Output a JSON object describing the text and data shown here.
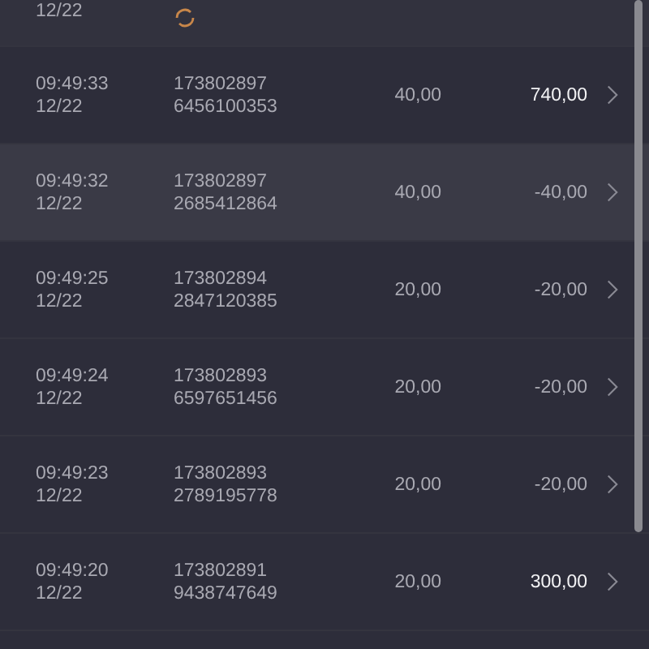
{
  "top_row": {
    "date": "12/22",
    "pending": true
  },
  "rows": [
    {
      "time": "09:49:33",
      "date": "12/22",
      "id_1": "173802897",
      "id_2": "6456100353",
      "quantity": "40,00",
      "amount": "740,00",
      "emphasis": true,
      "selected": false
    },
    {
      "time": "09:49:32",
      "date": "12/22",
      "id_1": "173802897",
      "id_2": "2685412864",
      "quantity": "40,00",
      "amount": "-40,00",
      "emphasis": false,
      "selected": true
    },
    {
      "time": "09:49:25",
      "date": "12/22",
      "id_1": "173802894",
      "id_2": "2847120385",
      "quantity": "20,00",
      "amount": "-20,00",
      "emphasis": false,
      "selected": false
    },
    {
      "time": "09:49:24",
      "date": "12/22",
      "id_1": "173802893",
      "id_2": "6597651456",
      "quantity": "20,00",
      "amount": "-20,00",
      "emphasis": false,
      "selected": false
    },
    {
      "time": "09:49:23",
      "date": "12/22",
      "id_1": "173802893",
      "id_2": "2789195778",
      "quantity": "20,00",
      "amount": "-20,00",
      "emphasis": false,
      "selected": false
    },
    {
      "time": "09:49:20",
      "date": "12/22",
      "id_1": "173802891",
      "id_2": "9438747649",
      "quantity": "20,00",
      "amount": "300,00",
      "emphasis": true,
      "selected": false
    }
  ]
}
